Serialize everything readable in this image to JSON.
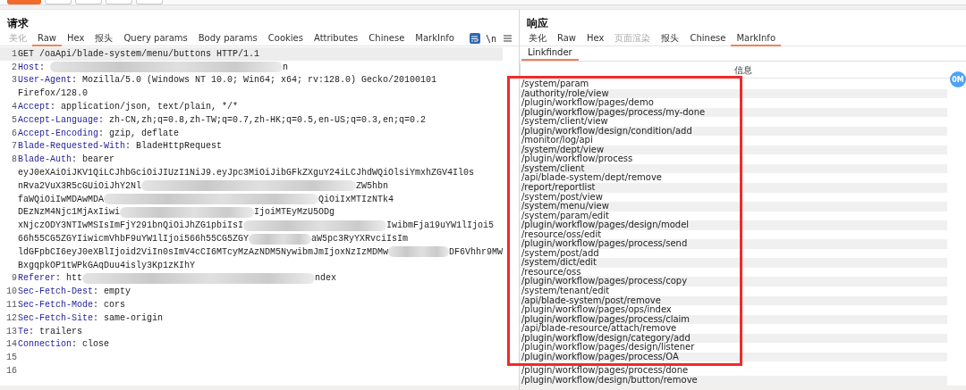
{
  "badge": "0M",
  "request": {
    "title": "请求",
    "tabs": [
      {
        "label": "美化",
        "selected": false,
        "disabled": true
      },
      {
        "label": "Raw",
        "selected": true,
        "disabled": false
      },
      {
        "label": "Hex",
        "selected": false,
        "disabled": false
      },
      {
        "label": "报头",
        "selected": false,
        "disabled": false
      },
      {
        "label": "Query params",
        "selected": false,
        "disabled": false
      },
      {
        "label": "Body params",
        "selected": false,
        "disabled": false
      },
      {
        "label": "Cookies",
        "selected": false,
        "disabled": false
      },
      {
        "label": "Attributes",
        "selected": false,
        "disabled": false
      },
      {
        "label": "Chinese",
        "selected": false,
        "disabled": false
      },
      {
        "label": "MarkInfo",
        "selected": false,
        "disabled": false
      }
    ],
    "newline_toggle": "\\n",
    "lines": [
      {
        "number": "1",
        "parts": [
          {
            "kind": "text",
            "text": "GET /oaApi/blade-system/menu/buttons HTTP/1.1"
          }
        ],
        "current": true
      },
      {
        "number": "2",
        "name": "Host",
        "colon": ":",
        "parts": [
          {
            "kind": "blur"
          },
          {
            "kind": "text",
            "text": "n"
          }
        ],
        "current": false
      },
      {
        "number": "3",
        "name": "User-Agent",
        "colon": ":",
        "parts": [
          {
            "kind": "text",
            "text": "Mozilla/5.0 (Windows NT 10.0; Win64; x64; rv:128.0) Gecko/20100101"
          }
        ],
        "current": false
      },
      {
        "parts": [
          {
            "kind": "text",
            "text": "Firefox/128.0"
          }
        ],
        "current": false
      },
      {
        "number": "4",
        "name": "Accept",
        "colon": ":",
        "parts": [
          {
            "kind": "text",
            "text": "application/json, text/plain, */*"
          }
        ],
        "current": false
      },
      {
        "number": "5",
        "name": "Accept-Language",
        "colon": ":",
        "parts": [
          {
            "kind": "text",
            "text": "zh-CN,zh;q=0.8,zh-TW;q=0.7,zh-HK;q=0.5,en-US;q=0.3,en;q=0.2"
          }
        ],
        "current": false
      },
      {
        "number": "6",
        "name": "Accept-Encoding",
        "colon": ":",
        "parts": [
          {
            "kind": "text",
            "text": "gzip, deflate"
          }
        ],
        "current": false
      },
      {
        "number": "7",
        "name": "Blade-Requested-With",
        "colon": ":",
        "parts": [
          {
            "kind": "text",
            "text": "BladeHttpRequest"
          }
        ],
        "current": false
      },
      {
        "number": "8",
        "name": "Blade-Auth",
        "colon": ":",
        "parts": [
          {
            "kind": "text",
            "text": "bearer"
          }
        ],
        "current": false
      },
      {
        "parts": [
          {
            "kind": "text",
            "text": "eyJ0eXAiOiJKV1QiLCJhbGciOiJIUzI1NiJ9.eyJpc3MiOiJibGFkZXguY24iLCJhdWQiOlsiYmxhZGV4Il0s"
          }
        ],
        "current": false
      },
      {
        "parts": [
          {
            "kind": "text",
            "text": "nRva2VuX3R5cGUiOiJhY2Nl"
          },
          {
            "kind": "blur"
          },
          {
            "kind": "text",
            "text": "ZW5hbn"
          }
        ],
        "current": false
      },
      {
        "parts": [
          {
            "kind": "text",
            "text": "faWQiOiIwMDAwMDA"
          },
          {
            "kind": "blur"
          },
          {
            "kind": "text",
            "text": "QiOiIxMTIzNTk4"
          }
        ],
        "current": false
      },
      {
        "parts": [
          {
            "kind": "text",
            "text": "DEzNzM4Njc1MjAxIiwi"
          },
          {
            "kind": "blur"
          },
          {
            "kind": "text",
            "text": "IjoiMTEyMzU5ODg"
          }
        ],
        "current": false
      },
      {
        "parts": [
          {
            "kind": "text",
            "text": "xNjczODY3NTIwMSIsImFjY291bnQiOiJhZG1pbiIsI"
          },
          {
            "kind": "blur"
          },
          {
            "kind": "text",
            "text": "IwibmFja19uYW1lIjoi5"
          }
        ],
        "current": false
      },
      {
        "parts": [
          {
            "kind": "text",
            "text": "66h55CG5ZGYIiwicmVhbF9uYW1lIjoi566h55CG5ZGY"
          },
          {
            "kind": "blur"
          },
          {
            "kind": "text",
            "text": "aW5pc3RyYXRvciIsIm"
          }
        ],
        "current": false
      },
      {
        "parts": [
          {
            "kind": "text",
            "text": "ldGFpbCI6eyJ0eXBlIjoid2ViIn0sImV4cCI6MTcyMzAzNDM5NywibmJmIjoxNzIzMDMw"
          },
          {
            "kind": "blur"
          },
          {
            "kind": "text",
            "text": "DF6Vhhr9MW"
          }
        ],
        "current": false
      },
      {
        "parts": [
          {
            "kind": "text",
            "text": "BxgqpkOP1tWPkGAqDuu4isly3Kp1zKIhY"
          }
        ],
        "current": false
      },
      {
        "number": "9",
        "name": "Referer",
        "colon": ":",
        "parts": [
          {
            "kind": "text",
            "text": "htt"
          },
          {
            "kind": "blur"
          },
          {
            "kind": "text",
            "text": "ndex"
          }
        ],
        "current": false
      },
      {
        "number": "10",
        "name": "Sec-Fetch-Dest",
        "colon": ":",
        "parts": [
          {
            "kind": "text",
            "text": "empty"
          }
        ],
        "current": false
      },
      {
        "number": "11",
        "name": "Sec-Fetch-Mode",
        "colon": ":",
        "parts": [
          {
            "kind": "text",
            "text": "cors"
          }
        ],
        "current": false
      },
      {
        "number": "12",
        "name": "Sec-Fetch-Site",
        "colon": ":",
        "parts": [
          {
            "kind": "text",
            "text": "same-origin"
          }
        ],
        "current": false
      },
      {
        "number": "13",
        "name": "Te",
        "colon": ":",
        "parts": [
          {
            "kind": "text",
            "text": "trailers"
          }
        ],
        "current": false
      },
      {
        "number": "14",
        "name": "Connection",
        "colon": ":",
        "parts": [
          {
            "kind": "text",
            "text": "close"
          }
        ],
        "current": false
      },
      {
        "number": "15",
        "current": false
      },
      {
        "number": "16",
        "current": false
      }
    ]
  },
  "response": {
    "title": "响应",
    "tabs": [
      {
        "label": "美化",
        "selected": false,
        "disabled": false
      },
      {
        "label": "Raw",
        "selected": false,
        "disabled": false
      },
      {
        "label": "Hex",
        "selected": false,
        "disabled": false
      },
      {
        "label": "页面渲染",
        "selected": false,
        "disabled": true
      },
      {
        "label": "报头",
        "selected": false,
        "disabled": false
      },
      {
        "label": "Chinese",
        "selected": false,
        "disabled": false
      },
      {
        "label": "MarkInfo",
        "selected": true,
        "disabled": false
      }
    ],
    "subtabs": [
      {
        "label": "Linkfinder",
        "selected": true
      }
    ],
    "table": {
      "columns": [
        "信息"
      ],
      "rows": [
        "/system/param",
        "/authority/role/view",
        "/plugin/workflow/pages/demo",
        "/plugin/workflow/pages/process/my-done",
        "/system/client/view",
        "/plugin/workflow/design/condition/add",
        "/monitor/log/api",
        "/system/dept/view",
        "/plugin/workflow/process",
        "/system/client",
        "/api/blade-system/dept/remove",
        "/report/reportlist",
        "/system/post/view",
        "/system/menu/view",
        "/system/param/edit",
        "/plugin/workflow/pages/design/model",
        "/resource/oss/edit",
        "/plugin/workflow/pages/process/send",
        "/system/post/add",
        "/system/dict/edit",
        "/resource/oss",
        "/plugin/workflow/pages/process/copy",
        "/system/tenant/edit",
        "/api/blade-system/post/remove",
        "/plugin/workflow/pages/ops/index",
        "/plugin/workflow/pages/process/claim",
        "/api/blade-resource/attach/remove",
        "/plugin/workflow/design/category/add",
        "/plugin/workflow/pages/design/listener",
        "/plugin/workflow/pages/process/OA",
        "/plugin/workflow/pages/process/done",
        "/plugin/workflow/design/button/remove"
      ]
    }
  }
}
